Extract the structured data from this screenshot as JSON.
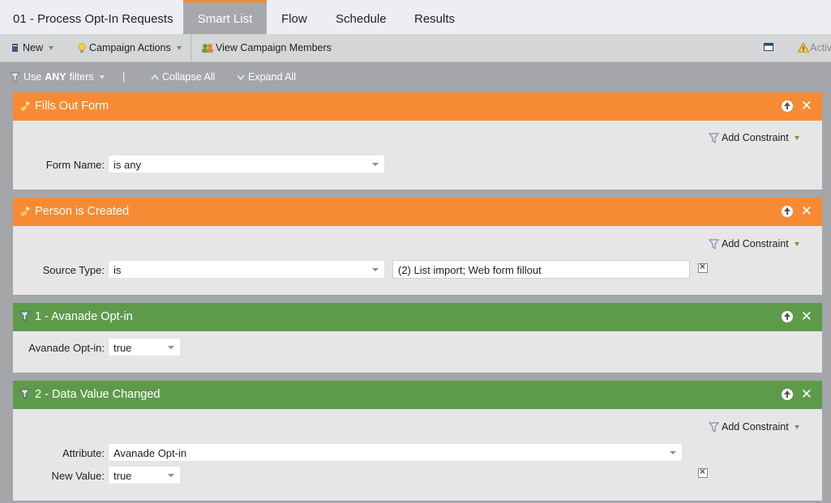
{
  "tabs": {
    "title": "01 - Process Opt-In Requests",
    "items": [
      {
        "label": "Smart List",
        "active": true
      },
      {
        "label": "Flow",
        "active": false
      },
      {
        "label": "Schedule",
        "active": false
      },
      {
        "label": "Results",
        "active": false
      }
    ]
  },
  "toolbar": {
    "new_label": "New",
    "campaign_actions_label": "Campaign Actions",
    "view_members_label": "View Campaign Members",
    "activity_label": "Activ"
  },
  "filterbar": {
    "use_label": "Use",
    "use_value": "ANY",
    "filters_label": "filters",
    "divider": "|",
    "collapse_label": "Collapse All",
    "expand_label": "Expand All"
  },
  "colors": {
    "trigger": "#f68b33",
    "filter": "#5d9b4b",
    "accent": "#f28a35"
  },
  "cards": [
    {
      "title": "Fills Out Form",
      "add_constraint": "Add Constraint",
      "rows": [
        {
          "label": "Form Name:",
          "value": "is any"
        }
      ]
    },
    {
      "title": "Person is Created",
      "add_constraint": "Add Constraint",
      "rows": [
        {
          "label": "Source Type:",
          "value": "is",
          "field": "(2) List import; Web form fillout"
        }
      ]
    },
    {
      "title": "1 - Avanade Opt-in",
      "rows": [
        {
          "label": "Avanade Opt-in:",
          "value": "true"
        }
      ]
    },
    {
      "title": "2 - Data Value Changed",
      "add_constraint": "Add Constraint",
      "rows": [
        {
          "label": "Attribute:",
          "value": "Avanade Opt-in"
        },
        {
          "label": "New Value:",
          "value": "true"
        }
      ]
    }
  ]
}
